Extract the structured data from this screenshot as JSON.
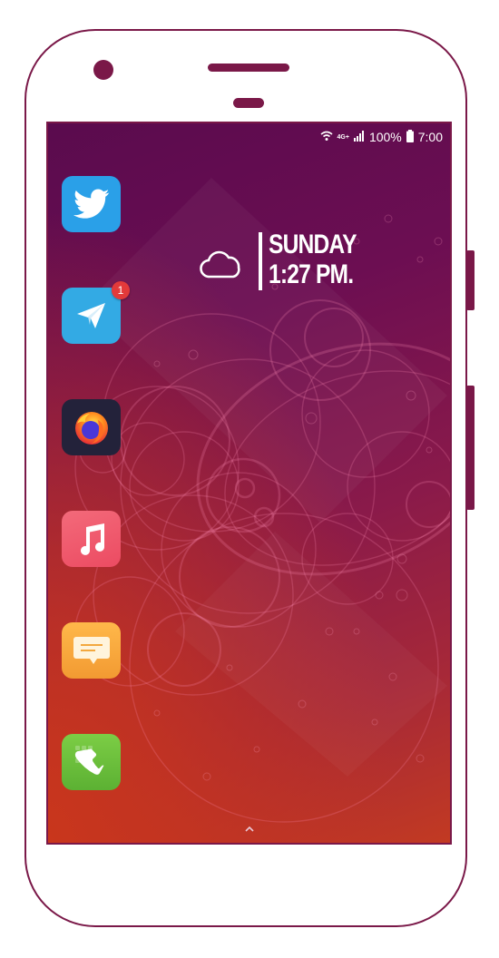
{
  "status_bar": {
    "wifi_icon": "wifi-icon",
    "network_type": "4G+",
    "signal_icon": "signal-icon",
    "battery_percent": "100%",
    "battery_icon": "battery-icon",
    "time": "7:00"
  },
  "clock_widget": {
    "weather_icon": "cloud-icon",
    "day": "SUNDAY",
    "time": "1:27 PM."
  },
  "dock_apps": [
    {
      "name": "Twitter",
      "icon": "twitter-icon",
      "color": "#2aa0e8"
    },
    {
      "name": "Telegram",
      "icon": "telegram-icon",
      "color": "#33aae4",
      "badge": "1"
    },
    {
      "name": "Firefox",
      "icon": "firefox-icon",
      "color": "#23223a"
    },
    {
      "name": "Music",
      "icon": "music-icon",
      "color": "#f05a6e"
    },
    {
      "name": "Messages",
      "icon": "message-icon",
      "color": "#f6a43a"
    },
    {
      "name": "Phone",
      "icon": "phone-icon",
      "color": "#6cc13c"
    }
  ],
  "app_drawer": {
    "icon": "chevron-up-icon"
  },
  "colors": {
    "device_accent": "#7a1848",
    "wallpaper_top": "#5a0b4e",
    "wallpaper_bottom": "#c23a22"
  }
}
